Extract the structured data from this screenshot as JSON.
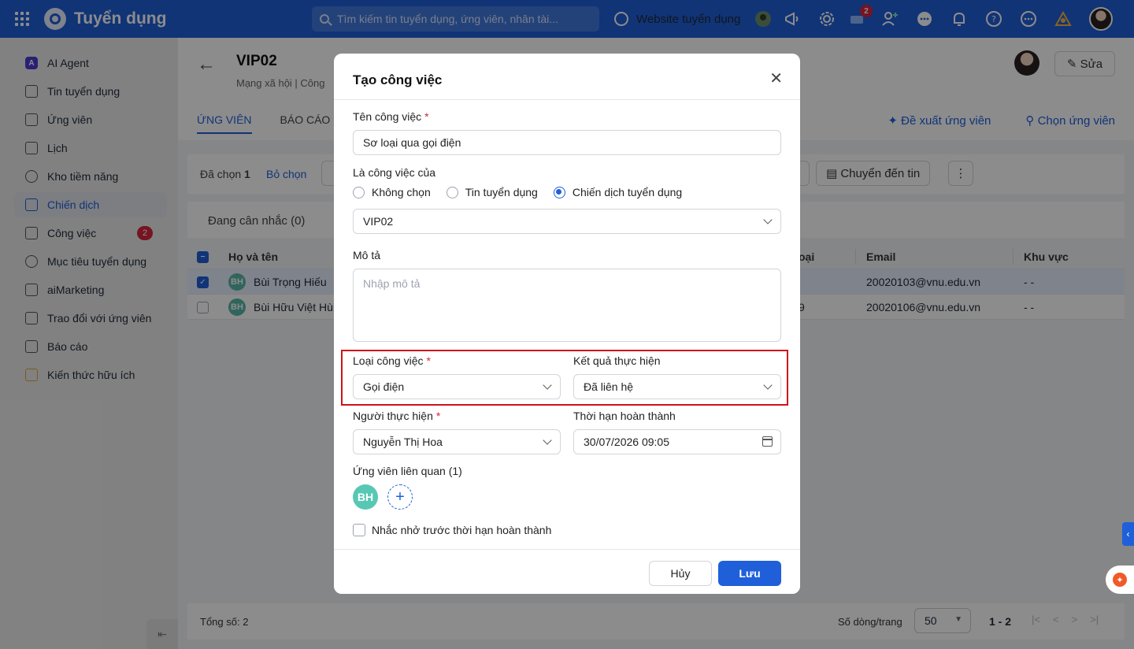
{
  "topbar": {
    "app_title": "Tuyển dụng",
    "search_placeholder": "Tìm kiếm tin tuyển dụng, ứng viên, nhân tài...",
    "website_label": "Website tuyển dụng",
    "cart_badge": "2"
  },
  "sidebar": {
    "items": [
      {
        "label": "AI Agent"
      },
      {
        "label": "Tin tuyển dụng"
      },
      {
        "label": "Ứng viên"
      },
      {
        "label": "Lịch"
      },
      {
        "label": "Kho tiềm năng"
      },
      {
        "label": "Chiến dịch"
      },
      {
        "label": "Công việc",
        "count": "2"
      },
      {
        "label": "Mục tiêu tuyển dụng"
      },
      {
        "label": "aiMarketing"
      },
      {
        "label": "Trao đổi với ứng viên"
      },
      {
        "label": "Báo cáo"
      },
      {
        "label": "Kiến thức hữu ích"
      }
    ]
  },
  "page": {
    "title": "VIP02",
    "subtitle": "Mạng xã hội  |  Công",
    "tabs": [
      "ỨNG VIÊN",
      "BÁO CÁO"
    ],
    "suggest_label": "Đề xuất ứng viên",
    "choose_label": "Chọn ứng viên",
    "edit_label": "Sửa",
    "selected_label": "Đã chọn",
    "selected_count": "1",
    "deselect_label": "Bỏ chọn",
    "move_label": "Chuyển đến tin",
    "filter_tab": "Đang cân nhắc (0)"
  },
  "table": {
    "headers": {
      "name": "Họ và tên",
      "phone": "oại",
      "email": "Email",
      "region": "Khu vực"
    },
    "rows": [
      {
        "initials": "BH",
        "name": "Bùi Trọng Hiếu",
        "phone": "",
        "email": "20020103@vnu.edu.vn",
        "region": "- -"
      },
      {
        "initials": "BH",
        "name": "Bùi Hữu Việt Hùn",
        "phone": "9",
        "email": "20020106@vnu.edu.vn",
        "region": "- -"
      }
    ]
  },
  "footer": {
    "total": "Tổng số: 2",
    "rows_per_page_label": "Số dòng/trang",
    "rows_per_page": "50",
    "range": "1 - 2"
  },
  "modal": {
    "title": "Tạo công việc",
    "task_name_label": "Tên công việc",
    "task_name_value": "Sơ loại qua gọi điện",
    "belongs_label": "Là công việc của",
    "radio_options": [
      "Không chọn",
      "Tin tuyển dụng",
      "Chiến dịch tuyển dụng"
    ],
    "selected_radio": "Chiến dịch tuyển dụng",
    "campaign_value": "VIP02",
    "description_label": "Mô tả",
    "description_placeholder": "Nhập mô tả",
    "task_type_label": "Loại công việc",
    "task_type_value": "Gọi điện",
    "result_label": "Kết quả thực hiện",
    "result_value": "Đã liên hệ",
    "assignee_label": "Người thực hiện",
    "assignee_value": "Nguyễn Thị Hoa",
    "deadline_label": "Thời hạn hoàn thành",
    "deadline_value": "30/07/2026 09:05",
    "related_label": "Ứng viên liên quan (1)",
    "related_initials": "BH",
    "reminder_label": "Nhắc nhở trước thời hạn hoàn thành",
    "cancel_label": "Hủy",
    "save_label": "Lưu"
  },
  "colors": {
    "primary": "#1f5fd9",
    "danger": "#d7263d",
    "highlight": "#d0121b"
  }
}
